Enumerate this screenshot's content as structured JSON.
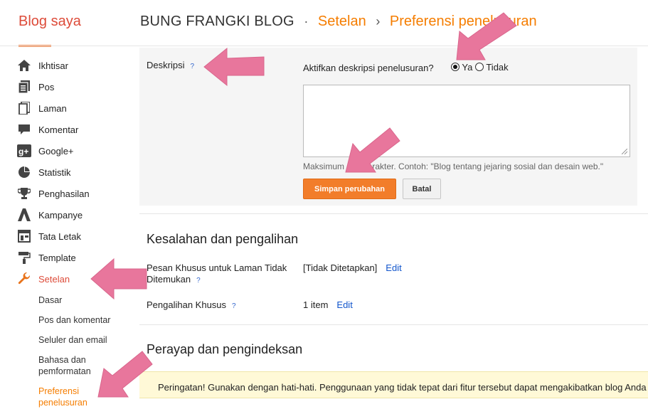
{
  "header": {
    "brand": "Blog saya",
    "blog_name": "BUNG FRANGKI BLOG",
    "sep1": "·",
    "crumb1": "Setelan",
    "sep2": "›",
    "crumb2": "Preferensi penelusuran"
  },
  "sidebar": {
    "items": [
      {
        "label": "Ikhtisar",
        "icon": "home-icon"
      },
      {
        "label": "Pos",
        "icon": "posts-icon"
      },
      {
        "label": "Laman",
        "icon": "pages-icon"
      },
      {
        "label": "Komentar",
        "icon": "comment-icon"
      },
      {
        "label": "Google+",
        "icon": "google-plus-icon"
      },
      {
        "label": "Statistik",
        "icon": "pie-chart-icon"
      },
      {
        "label": "Penghasilan",
        "icon": "trophy-icon"
      },
      {
        "label": "Kampanye",
        "icon": "adwords-icon"
      },
      {
        "label": "Tata Letak",
        "icon": "layout-icon"
      },
      {
        "label": "Template",
        "icon": "paint-roller-icon"
      },
      {
        "label": "Setelan",
        "icon": "wrench-icon"
      }
    ],
    "sub_items": [
      "Dasar",
      "Pos dan komentar",
      "Seluler dan email",
      "Bahasa dan pemformatan",
      "Preferensi penelusuran"
    ],
    "colors": {
      "active": "#dd4b39",
      "sub_active": "#f57d00"
    }
  },
  "description": {
    "label": "Deskripsi",
    "help": "?",
    "enable_question": "Aktifkan deskripsi penelusuran?",
    "option_yes": "Ya",
    "option_no": "Tidak",
    "selected": "Ya",
    "textarea_value": "",
    "hint": "Maksimum 150 karakter. Contoh: \"Blog tentang jejaring sosial dan desain web.\"",
    "save_label": "Simpan perubahan",
    "cancel_label": "Batal"
  },
  "errors_section": {
    "title": "Kesalahan dan pengalihan",
    "row1_label": "Pesan Khusus untuk Laman Tidak Ditemukan",
    "row1_value": "[Tidak Ditetapkan]",
    "row1_link": "Edit",
    "row2_label": "Pengalihan Khusus",
    "row2_value": "1 item",
    "row2_link": "Edit",
    "help": "?"
  },
  "crawl_section": {
    "title": "Perayap dan pengindeksan",
    "warning": "Peringatan! Gunakan dengan hati-hati. Penggunaan yang tidak tepat dari fitur tersebut dapat mengakibatkan blog Anda diabaikan oleh mesin telusur."
  },
  "colors": {
    "accent": "#f57d00",
    "button": "#f27d2a",
    "arrow": "#e8769c",
    "link": "#1155cc"
  }
}
